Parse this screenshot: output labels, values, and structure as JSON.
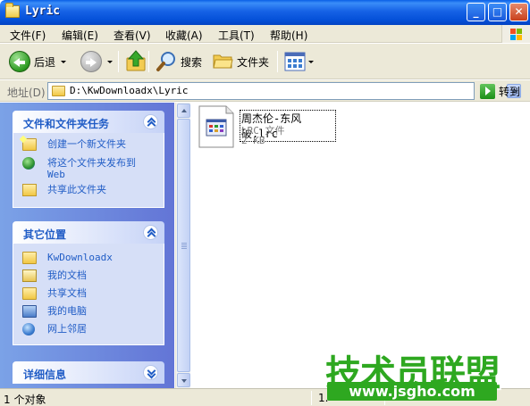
{
  "window": {
    "title": "Lyric",
    "minimize_label": "_",
    "maximize_label": "□",
    "close_label": "✕"
  },
  "menu": [
    "文件(F)",
    "编辑(E)",
    "查看(V)",
    "收藏(A)",
    "工具(T)",
    "帮助(H)"
  ],
  "toolbar": {
    "back_label": "后退",
    "search_label": "搜索",
    "folders_label": "文件夹"
  },
  "address": {
    "label": "地址(D)",
    "value": "D:\\KwDownloadx\\Lyric",
    "go_label": "转到"
  },
  "tasks_panel": {
    "title": "文件和文件夹任务",
    "items": [
      {
        "label": "创建一个新文件夹",
        "icon": "new-folder-icon"
      },
      {
        "label": "将这个文件夹发布到",
        "label2": "Web",
        "icon": "publish-web-icon"
      },
      {
        "label": "共享此文件夹",
        "icon": "share-folder-icon"
      }
    ]
  },
  "places_panel": {
    "title": "其它位置",
    "items": [
      {
        "label": "KwDownloadx",
        "icon": "folder-icon"
      },
      {
        "label": "我的文档",
        "icon": "my-documents-icon"
      },
      {
        "label": "共享文档",
        "icon": "shared-documents-icon"
      },
      {
        "label": "我的电脑",
        "icon": "my-computer-icon"
      },
      {
        "label": "网上邻居",
        "icon": "network-places-icon"
      }
    ]
  },
  "details_panel": {
    "title": "详细信息"
  },
  "file": {
    "name": "周杰伦-东风破.lrc",
    "type": "LRC 文件",
    "size": "2 KB"
  },
  "status": {
    "left": "1 个对象",
    "mid": "1."
  },
  "watermark": {
    "brand": "技术员联盟",
    "url": "www.jsgho.com"
  },
  "colors": {
    "title_bar": "#0a5fe6",
    "task_pane": "#7ba2e7",
    "link": "#215dc6",
    "watermark": "#2ea820"
  }
}
